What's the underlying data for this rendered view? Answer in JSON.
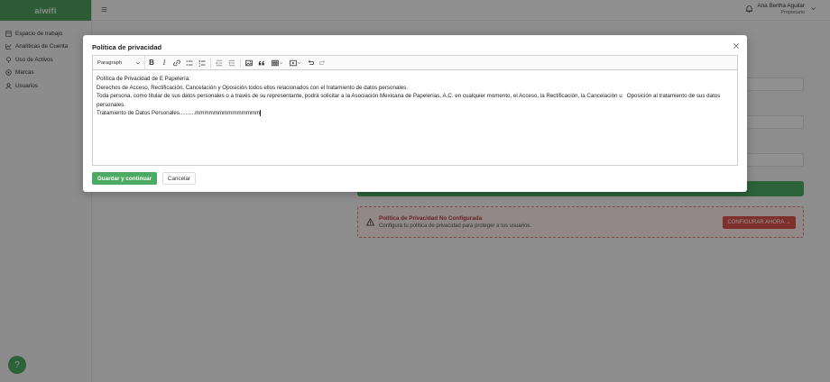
{
  "app": {
    "logo_text": "aiwifi"
  },
  "sidebar": {
    "items": [
      {
        "label": "Espacio de trabajo",
        "icon": "workspace-icon"
      },
      {
        "label": "Analíticas de Cuenta",
        "icon": "analytics-icon"
      },
      {
        "label": "Uso de Activos",
        "icon": "assets-icon"
      },
      {
        "label": "Marcas",
        "icon": "brands-icon"
      },
      {
        "label": "Usuarios",
        "icon": "user-icon"
      }
    ]
  },
  "header": {
    "user_name": "Ana Bertha Aguilar",
    "user_role": "Propietario"
  },
  "background": {
    "alert_title": "Política de Privacidad No Configurada",
    "alert_subtitle": "Configura tu política de privacidad para proteger a tus usuarios.",
    "alert_button": "CONFIGURAR AHORA →"
  },
  "modal": {
    "title": "Política de privacidad",
    "editor": {
      "block_format": "Paragraph",
      "lines": [
        "Política de Privacidad de E Papelería:",
        "Derechos de Acceso, Rectificación, Cancelación y Oposición todos ellos relacionados con el tratamiento de datos personales.",
        "Toda persona, como titular de sus datos personales o a través de su representante, podrá solicitar a la Asociación Mexicana de Papelerías, A.C. en cualquier momento, el Acceso, la Rectificación, la Cancelación u   Oposición al tratamiento de sus datos personales.",
        "Tratamiento de Datos Personales..........mmmmmmmmmmmmmm"
      ]
    },
    "save_label": "Guardar y continuar",
    "cancel_label": "Cancelar"
  },
  "help": {
    "label": "?"
  },
  "colors": {
    "brand_green": "#4caa62",
    "alert_red": "#d9534f"
  }
}
